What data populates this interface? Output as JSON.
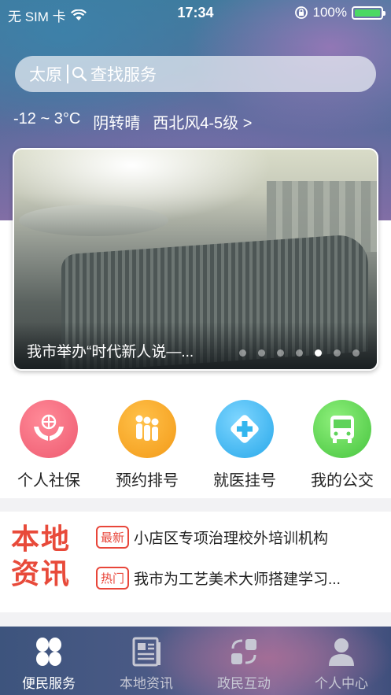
{
  "status_bar": {
    "carrier": "无 SIM 卡",
    "time": "17:34",
    "battery": "100%",
    "battery_level": 1.0,
    "battery_color": "#4cd964"
  },
  "search": {
    "city": "太原",
    "placeholder": "查找服务",
    "icon": "search-icon"
  },
  "weather": {
    "temp": "-12 ~ 3°C",
    "condition": "阴转晴",
    "wind": "西北风4-5级 >"
  },
  "banner": {
    "caption": "我市举办“时代新人说—...",
    "dot_count": 7,
    "active_dot": 5
  },
  "services": [
    {
      "label": "个人社保",
      "icon": "hands-globe-icon",
      "color": "#f2677a"
    },
    {
      "label": "预约排号",
      "icon": "queue-people-icon",
      "color": "#f6a623"
    },
    {
      "label": "就医挂号",
      "icon": "medical-cross-icon",
      "color": "#34b6ee"
    },
    {
      "label": "我的公交",
      "icon": "bus-icon",
      "color": "#5fd35a"
    }
  ],
  "news": {
    "brand_line1": "本地",
    "brand_line2": "资讯",
    "items": [
      {
        "tag": "最新",
        "text": "小店区专项治理校外培训机构"
      },
      {
        "tag": "热门",
        "text": "我市为工艺美术大师搭建学习..."
      }
    ]
  },
  "tabs": [
    {
      "label": "便民服务",
      "icon": "clover-grid-icon",
      "active": true
    },
    {
      "label": "本地资讯",
      "icon": "newspaper-icon",
      "active": false
    },
    {
      "label": "政民互动",
      "icon": "exchange-icon",
      "active": false
    },
    {
      "label": "个人中心",
      "icon": "user-icon",
      "active": false
    }
  ]
}
